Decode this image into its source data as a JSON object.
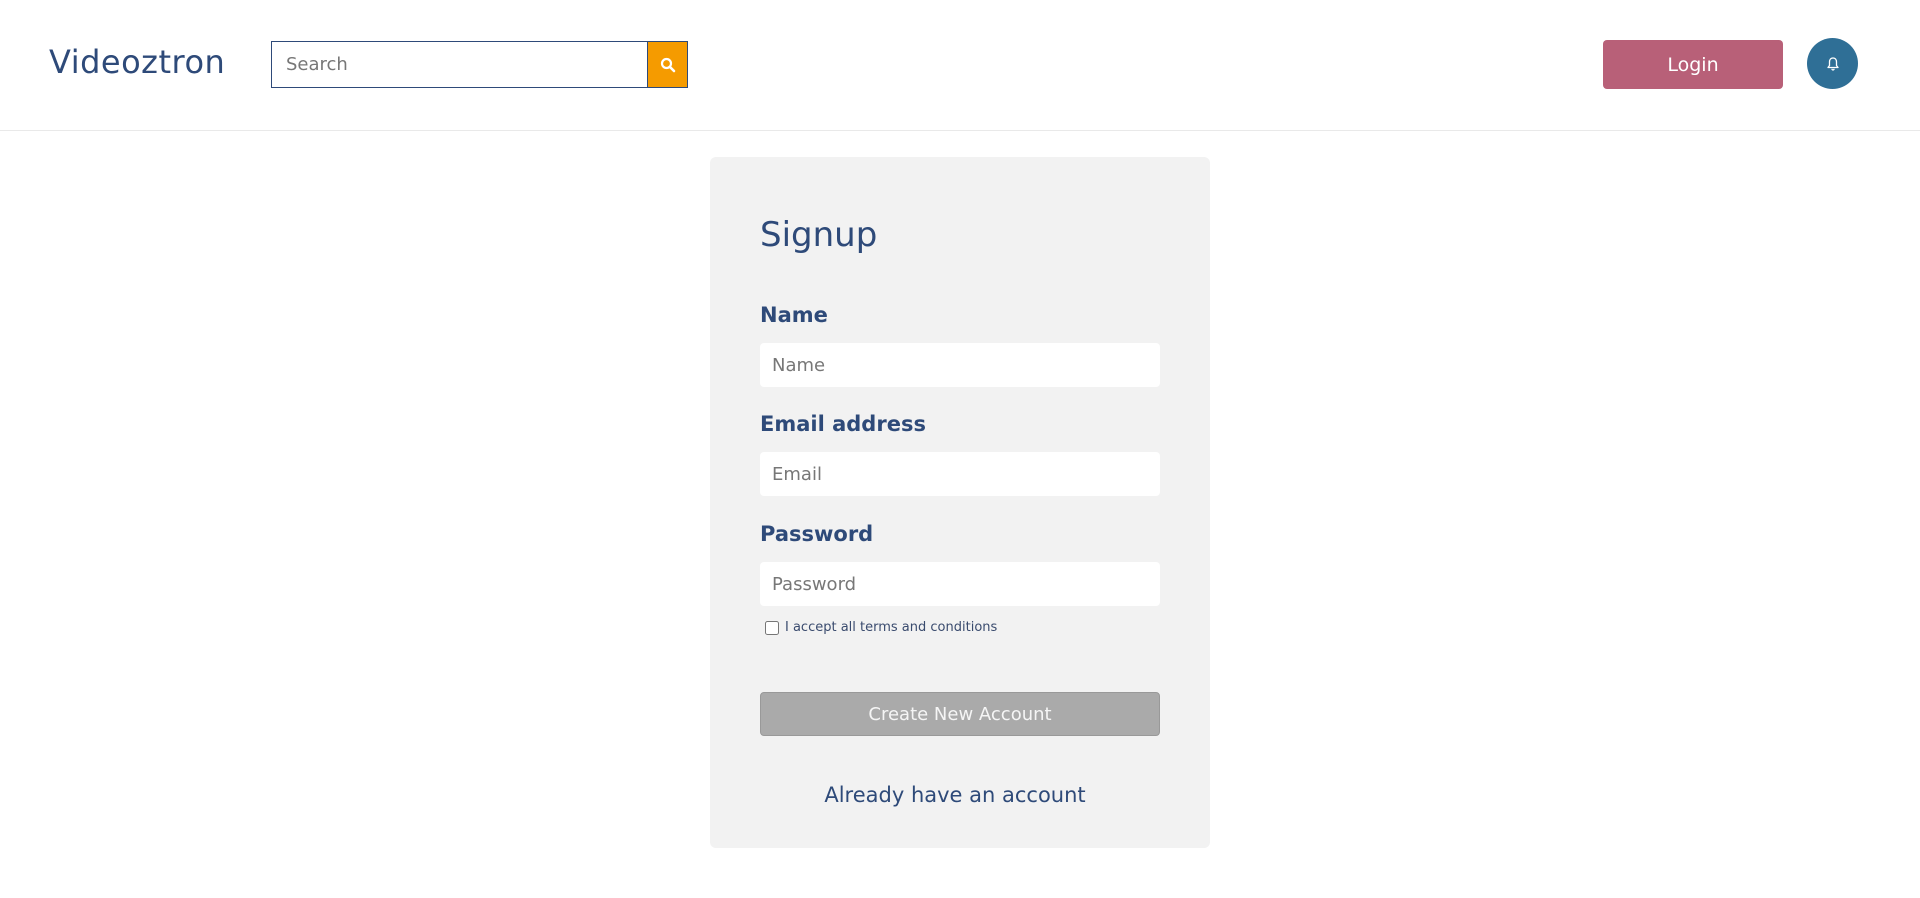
{
  "header": {
    "brand": "Videoztron",
    "search": {
      "placeholder": "Search",
      "value": ""
    },
    "search_icon": "search-icon",
    "login_label": "Login",
    "bell_icon": "bell-icon"
  },
  "signup": {
    "title": "Signup",
    "name": {
      "label": "Name",
      "placeholder": "Name",
      "value": ""
    },
    "email": {
      "label": "Email address",
      "placeholder": "Email",
      "value": ""
    },
    "password": {
      "label": "Password",
      "placeholder": "Password",
      "value": ""
    },
    "terms_label": "I accept all terms and conditions",
    "terms_checked": false,
    "create_label": "Create New Account",
    "already_label": "Already have an account"
  },
  "colors": {
    "brand": "#2e4a79",
    "search_button": "#f59b00",
    "login_button": "#b86078",
    "bell_button": "#2f6f96",
    "card_background": "#f2f2f2",
    "create_button_disabled": "#aaaaaa"
  }
}
